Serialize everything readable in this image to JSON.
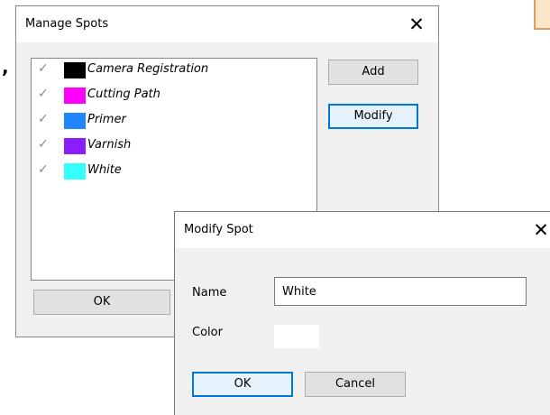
{
  "manage_spots": {
    "title": "Manage Spots",
    "close_glyph": "✕",
    "spots": [
      {
        "label": "Camera Registration",
        "color": "#000000"
      },
      {
        "label": "Cutting Path",
        "color": "#ff00ff"
      },
      {
        "label": "Primer",
        "color": "#1e86ff"
      },
      {
        "label": "Varnish",
        "color": "#8a1cff"
      },
      {
        "label": "White",
        "color": "#33ffff"
      }
    ],
    "check_glyph": "✓",
    "add_label": "Add",
    "modify_label": "Modify",
    "ok_label": "OK"
  },
  "modify_spot": {
    "title": "Modify Spot",
    "close_glyph": "✕",
    "name_label": "Name",
    "name_value": "White",
    "color_label": "Color",
    "color_value": "#ffffff",
    "ok_label": "OK",
    "cancel_label": "Cancel"
  },
  "background": {
    "comma_text": ","
  }
}
